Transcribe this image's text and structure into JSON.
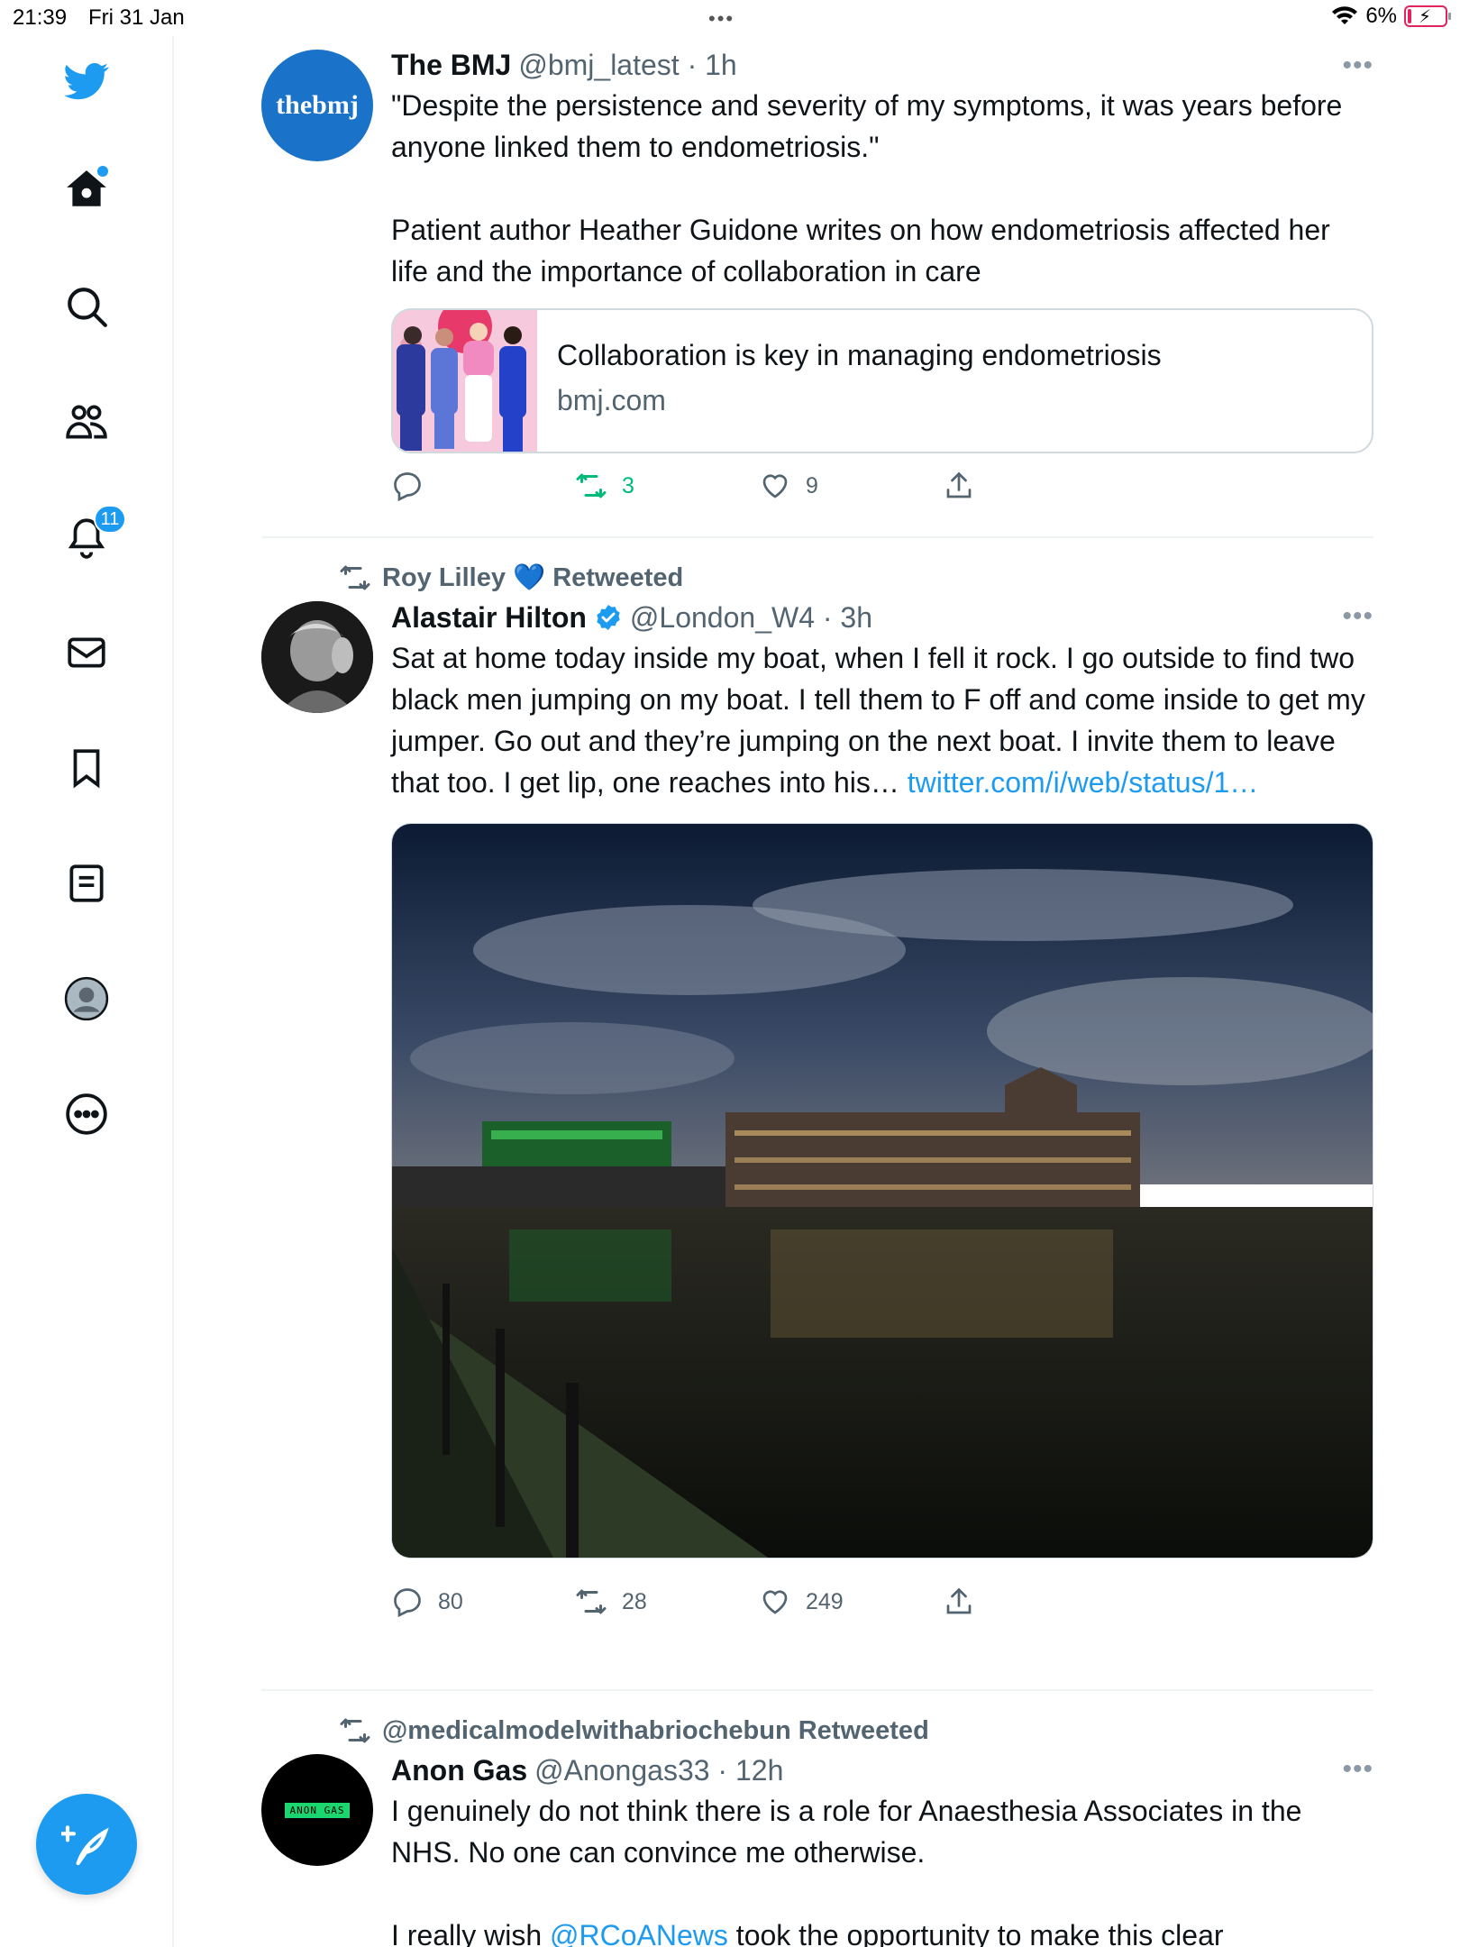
{
  "status": {
    "time": "21:39",
    "date": "Fri 31 Jan",
    "battery": "6%"
  },
  "sidebar": {
    "items": [
      {
        "name": "twitter-logo",
        "icon": "twitter-bird-icon"
      },
      {
        "name": "home",
        "icon": "home-icon"
      },
      {
        "name": "explore",
        "icon": "search-icon"
      },
      {
        "name": "communities",
        "icon": "people-icon"
      },
      {
        "name": "notifications",
        "icon": "bell-icon"
      },
      {
        "name": "messages",
        "icon": "mail-icon"
      },
      {
        "name": "bookmarks",
        "icon": "bookmark-icon"
      },
      {
        "name": "lists",
        "icon": "list-icon"
      },
      {
        "name": "profile",
        "icon": "profile-icon"
      },
      {
        "name": "more",
        "icon": "more-circle-icon"
      }
    ],
    "notifications_badge": "11",
    "compose_icon": "compose-feather-icon",
    "accent": "#1d9bf0"
  },
  "tweets": [
    {
      "name": "The BMJ",
      "handle": "@bmj_latest · 1h",
      "avatar_text": "thebmj",
      "text1": "\"Despite the persistence and severity of my symptoms, it was years before anyone linked them to endometriosis.\"",
      "text2": "Patient author Heather Guidone writes on how endometriosis affected her life and the importance of collaboration in care",
      "card": {
        "title": "Collaboration is key in managing endometriosis",
        "domain": "bmj.com"
      },
      "reply_count": "",
      "retweet_count": "3",
      "like_count": "9",
      "retweeted_by_me": true
    },
    {
      "retweeted_by": "Roy Lilley 💙 Retweeted",
      "name": "Alastair Hilton",
      "handle": "@London_W4 · 3h",
      "verified": true,
      "text": "Sat at home today inside my boat, when I fell it rock. I go outside to find two black men jumping on my boat. I tell them to F off and come inside to get my jumper. Go out and they’re jumping on the next boat. I invite them to leave that too. I get lip, one reaches into his… ",
      "link": "twitter.com/i/web/status/1…",
      "reply_count": "80",
      "retweet_count": "28",
      "like_count": "249"
    },
    {
      "retweeted_by": "@medicalmodelwithabriochebun Retweeted",
      "name": "Anon Gas",
      "handle": "@Anongas33 · 12h",
      "avatar_text": "ANON GAS",
      "text1": "I genuinely do not think there is a role for Anaesthesia Associates in the NHS. No one can convince me otherwise.",
      "text2_start": "I really wish ",
      "text2_mention": "@RCoANews",
      "text2_end": " took the opportunity to make this clear"
    }
  ]
}
